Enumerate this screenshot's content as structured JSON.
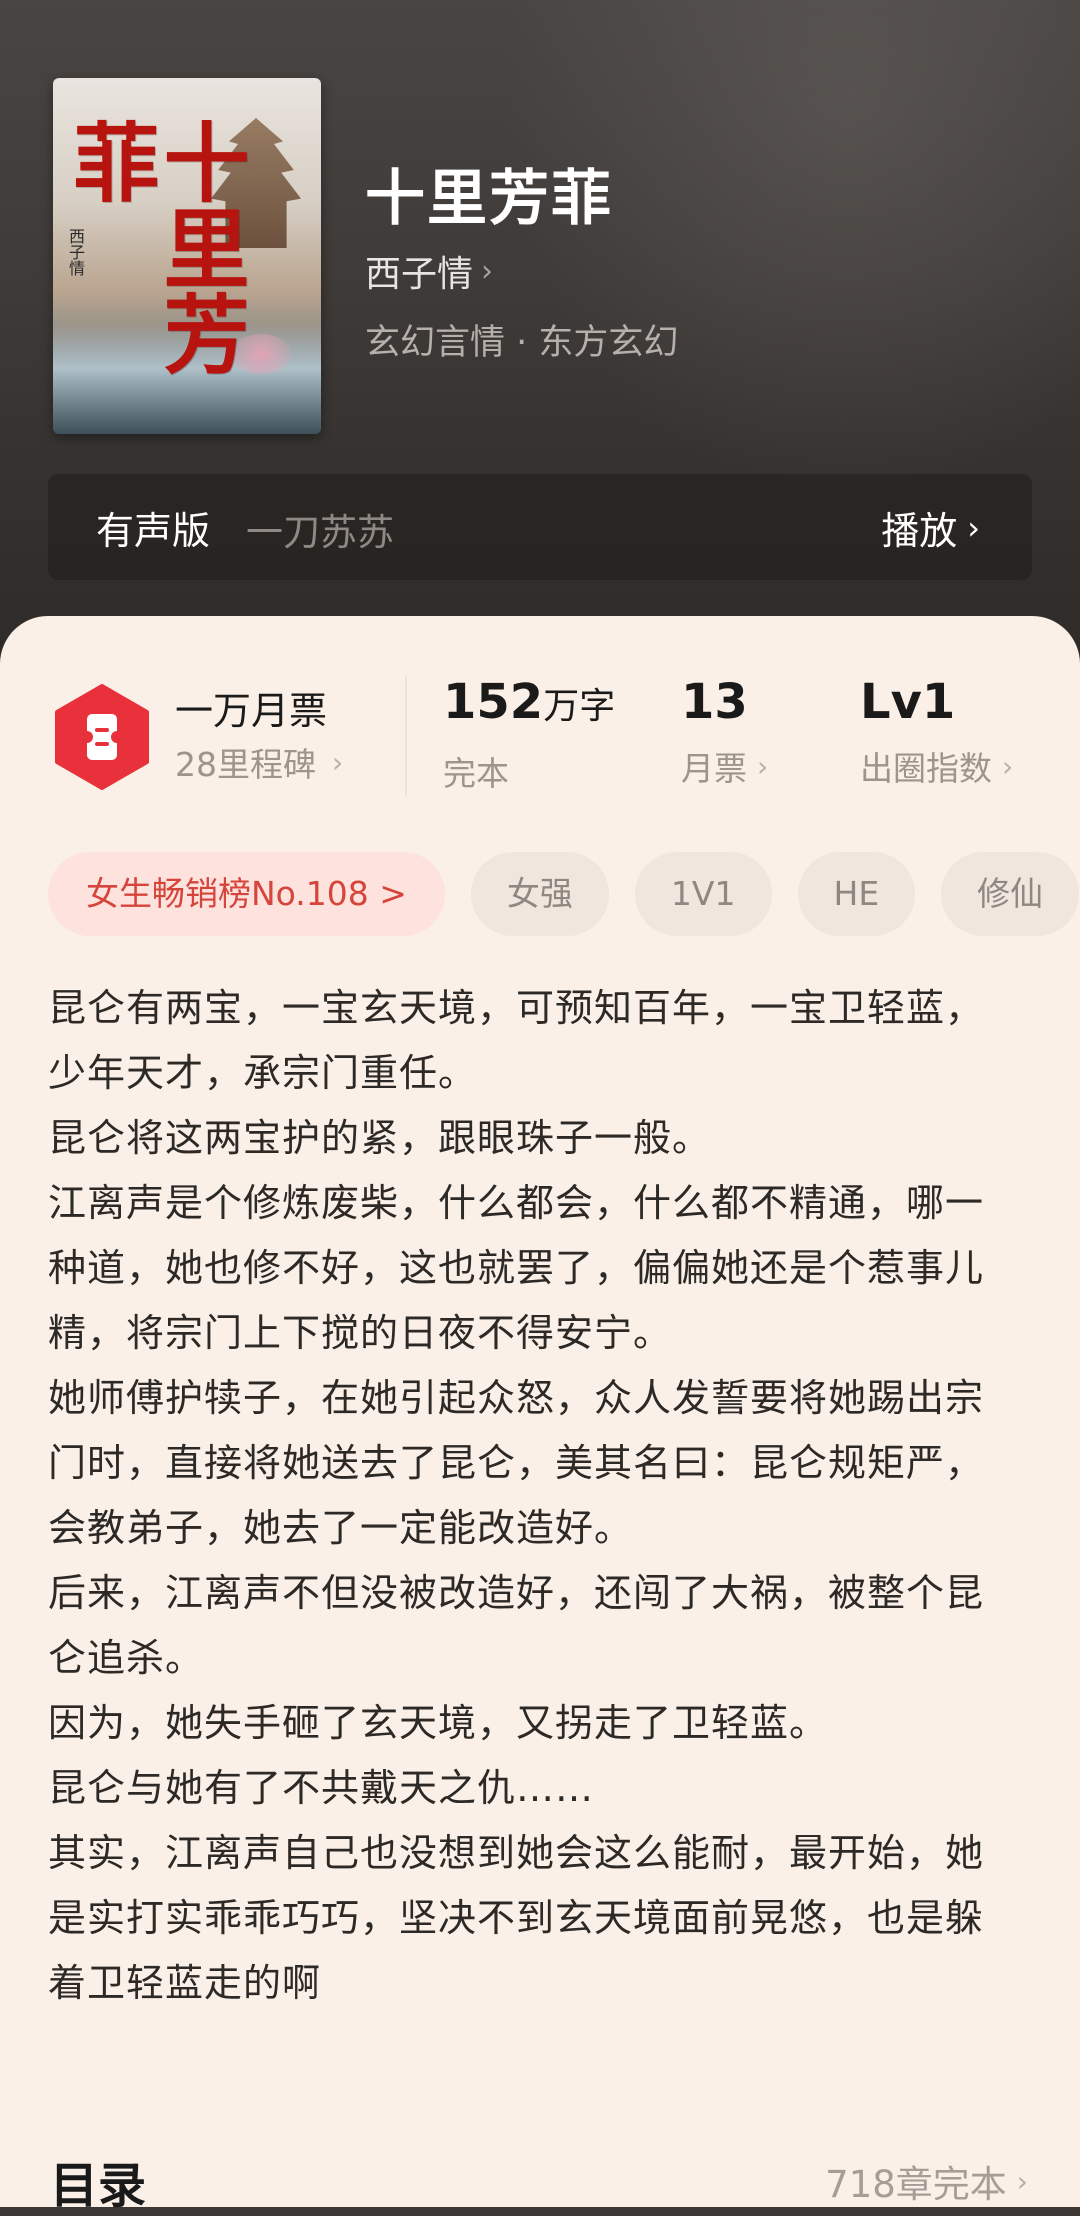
{
  "book": {
    "title": "十里芳菲",
    "author": "西子情",
    "genre": "玄幻言情 · 东方玄幻",
    "cover": {
      "title_text": "十里芳菲",
      "author_text": "西子情"
    }
  },
  "audio": {
    "label": "有声版",
    "narrator": "一刀苏苏",
    "play_label": "播放"
  },
  "stats": {
    "monthly": {
      "title": "一万月票",
      "subtitle": "28里程碑"
    },
    "words": {
      "value": "152",
      "unit": "万字",
      "label": "完本"
    },
    "tickets": {
      "value": "13",
      "label": "月票"
    },
    "level": {
      "value": "Lv1",
      "label": "出圈指数"
    }
  },
  "tags": [
    "女生畅销榜No.108 >",
    "女强",
    "1V1",
    "HE",
    "修仙"
  ],
  "synopsis": [
    "昆仑有两宝，一宝玄天境，可预知百年，一宝卫轻蓝，少年天才，承宗门重任。",
    "昆仑将这两宝护的紧，跟眼珠子一般。",
    "江离声是个修炼废柴，什么都会，什么都不精通，哪一种道，她也修不好，这也就罢了，偏偏她还是个惹事儿精，将宗门上下搅的日夜不得安宁。",
    "她师傅护犊子，在她引起众怒，众人发誓要将她踢出宗门时，直接将她送去了昆仑，美其名曰：昆仑规矩严，会教弟子，她去了一定能改造好。",
    "后来，江离声不但没被改造好，还闯了大祸，被整个昆仑追杀。",
    "因为，她失手砸了玄天境，又拐走了卫轻蓝。",
    "昆仑与她有了不共戴天之仇……",
    "其实，江离声自己也没想到她会这么能耐，最开始，她是实打实乖乖巧巧，坚决不到玄天境面前晃悠，也是躲着卫轻蓝走的啊"
  ],
  "toc": {
    "title": "目录",
    "count": "718章完本"
  },
  "colors": {
    "sheet_bg": "#faf0e8",
    "accent_red": "#e8313a",
    "hot_tag_text": "#d6453b"
  },
  "icons": {
    "ticket": "ticket-badge-icon",
    "chevron": "chevron-right-icon"
  }
}
